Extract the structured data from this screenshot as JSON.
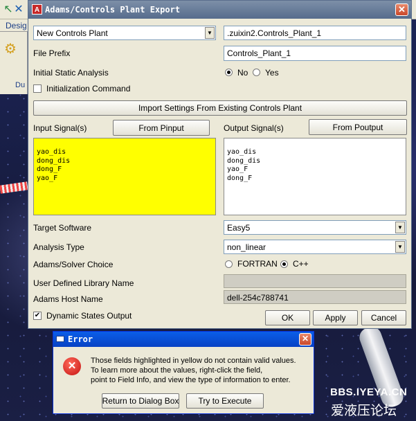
{
  "background": {
    "tab_label": "Desig",
    "panel_label": "Du",
    "watermark_line1": "BBS.IYEYA.CN",
    "watermark_line2": "爱液压论坛"
  },
  "dialog": {
    "title": "Adams/Controls Plant Export",
    "title_icon_letter": "A",
    "close_glyph": "✕",
    "plant_select": "New Controls Plant",
    "plant_name": ".zuixin2.Controls_Plant_1",
    "file_prefix_label": "File Prefix",
    "file_prefix": "Controls_Plant_1",
    "initial_static_label": "Initial Static Analysis",
    "initial_static_no": "No",
    "initial_static_yes": "Yes",
    "init_command_label": "Initialization Command",
    "import_settings_button": "Import Settings From Existing Controls Plant",
    "input_signals_label": "Input Signal(s)",
    "from_pinput_button": "From Pinput",
    "output_signals_label": "Output Signal(s)",
    "from_poutput_button": "From Poutput",
    "input_signals": [
      "yao_dis",
      "dong_dis",
      "dong_F",
      "yao_F"
    ],
    "output_signals": [
      "yao_dis",
      "dong_dis",
      "yao_F",
      "dong_F"
    ],
    "target_software_label": "Target Software",
    "target_software": "Easy5",
    "analysis_type_label": "Analysis Type",
    "analysis_type": "non_linear",
    "solver_choice_label": "Adams/Solver Choice",
    "solver_fortran": "FORTRAN",
    "solver_cpp": "C++",
    "user_library_label": "User Defined Library Name",
    "user_library": "",
    "host_name_label": "Adams Host Name",
    "host_name": "dell-254c788741",
    "dynamic_states_label": "Dynamic States Output",
    "ok_button": "OK",
    "apply_button": "Apply",
    "cancel_button": "Cancel"
  },
  "error": {
    "title": "Error",
    "close_glyph": "✕",
    "icon_glyph": "✕",
    "line1": "Those fields highlighted in yellow do not contain valid values.",
    "line2": "To learn more about the values, right-click the field,",
    "line3": "point to Field Info, and view the type of information to enter.",
    "return_button": "Return to Dialog Box",
    "try_button": "Try to Execute"
  },
  "colors": {
    "invalid_field": "#ffff00",
    "dialog_title": "#566c8c",
    "error_title": "#0842c4"
  }
}
